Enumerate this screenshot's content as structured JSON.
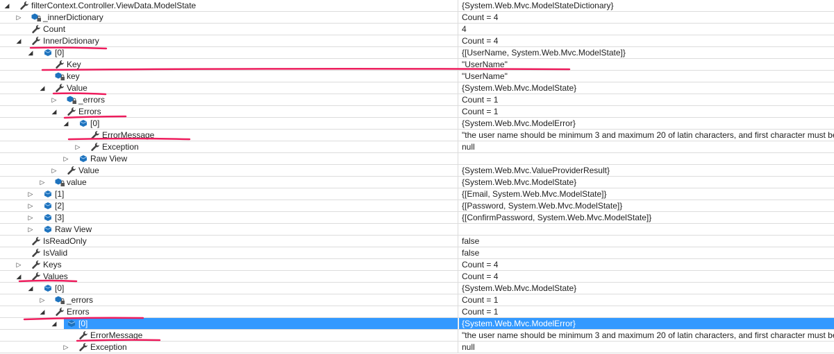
{
  "colors": {
    "selection": "#3399ff",
    "annotation": "#ee1d5d"
  },
  "rows": [
    {
      "level": 0,
      "expander": "expanded",
      "icon": "wrench-icon",
      "name": "filterContext.Controller.ViewData.ModelState",
      "value": "{System.Web.Mvc.ModelStateDictionary}"
    },
    {
      "level": 1,
      "expander": "collapsed",
      "icon": "private-field-icon",
      "name": "_innerDictionary",
      "value": "Count = 4"
    },
    {
      "level": 1,
      "expander": "none",
      "icon": "wrench-icon",
      "name": "Count",
      "value": "4"
    },
    {
      "level": 1,
      "expander": "expanded",
      "icon": "wrench-icon",
      "name": "InnerDictionary",
      "value": "Count = 4"
    },
    {
      "level": 2,
      "expander": "expanded",
      "icon": "object-icon",
      "name": "[0]",
      "value": "{[UserName, System.Web.Mvc.ModelState]}"
    },
    {
      "level": 3,
      "expander": "none",
      "icon": "wrench-icon",
      "name": "Key",
      "value": "\"UserName\""
    },
    {
      "level": 3,
      "expander": "none",
      "icon": "private-field-icon",
      "name": "key",
      "value": "\"UserName\""
    },
    {
      "level": 3,
      "expander": "expanded",
      "icon": "wrench-icon",
      "name": "Value",
      "value": "{System.Web.Mvc.ModelState}"
    },
    {
      "level": 4,
      "expander": "collapsed",
      "icon": "private-field-icon",
      "name": "_errors",
      "value": "Count = 1"
    },
    {
      "level": 4,
      "expander": "expanded",
      "icon": "wrench-icon",
      "name": "Errors",
      "value": "Count = 1"
    },
    {
      "level": 5,
      "expander": "expanded",
      "icon": "object-icon",
      "name": "[0]",
      "value": "{System.Web.Mvc.ModelError}"
    },
    {
      "level": 6,
      "expander": "none",
      "icon": "wrench-icon",
      "name": "ErrorMessage",
      "value": "\"the user name should be minimum 3 and maximum 20 of latin characters, and first character must be"
    },
    {
      "level": 6,
      "expander": "collapsed",
      "icon": "wrench-icon",
      "name": "Exception",
      "value": "null"
    },
    {
      "level": 5,
      "expander": "collapsed",
      "icon": "object-icon",
      "name": "Raw View",
      "value": ""
    },
    {
      "level": 4,
      "expander": "collapsed",
      "icon": "wrench-icon",
      "name": "Value",
      "value": "{System.Web.Mvc.ValueProviderResult}"
    },
    {
      "level": 3,
      "expander": "collapsed",
      "icon": "private-field-icon",
      "name": "value",
      "value": "{System.Web.Mvc.ModelState}"
    },
    {
      "level": 2,
      "expander": "collapsed",
      "icon": "object-icon",
      "name": "[1]",
      "value": "{[Email, System.Web.Mvc.ModelState]}"
    },
    {
      "level": 2,
      "expander": "collapsed",
      "icon": "object-icon",
      "name": "[2]",
      "value": "{[Password, System.Web.Mvc.ModelState]}"
    },
    {
      "level": 2,
      "expander": "collapsed",
      "icon": "object-icon",
      "name": "[3]",
      "value": "{[ConfirmPassword, System.Web.Mvc.ModelState]}"
    },
    {
      "level": 2,
      "expander": "collapsed",
      "icon": "object-icon",
      "name": "Raw View",
      "value": ""
    },
    {
      "level": 1,
      "expander": "none",
      "icon": "wrench-icon",
      "name": "IsReadOnly",
      "value": "false"
    },
    {
      "level": 1,
      "expander": "none",
      "icon": "wrench-icon",
      "name": "IsValid",
      "value": "false"
    },
    {
      "level": 1,
      "expander": "collapsed",
      "icon": "wrench-icon",
      "name": "Keys",
      "value": "Count = 4"
    },
    {
      "level": 1,
      "expander": "expanded",
      "icon": "wrench-icon",
      "name": "Values",
      "value": "Count = 4"
    },
    {
      "level": 2,
      "expander": "expanded",
      "icon": "object-icon",
      "name": "[0]",
      "value": "{System.Web.Mvc.ModelState}"
    },
    {
      "level": 3,
      "expander": "collapsed",
      "icon": "private-field-icon",
      "name": "_errors",
      "value": "Count = 1"
    },
    {
      "level": 3,
      "expander": "expanded",
      "icon": "wrench-icon",
      "name": "Errors",
      "value": "Count = 1"
    },
    {
      "level": 4,
      "expander": "expanded",
      "icon": "object-icon",
      "name": "[0]",
      "value": "{System.Web.Mvc.ModelError}",
      "selected": true
    },
    {
      "level": 5,
      "expander": "none",
      "icon": "wrench-icon",
      "name": "ErrorMessage",
      "value": "\"the user name should be minimum 3 and maximum 20 of latin characters, and first character must be"
    },
    {
      "level": 5,
      "expander": "collapsed",
      "icon": "wrench-icon",
      "name": "Exception",
      "value": "null"
    }
  ]
}
